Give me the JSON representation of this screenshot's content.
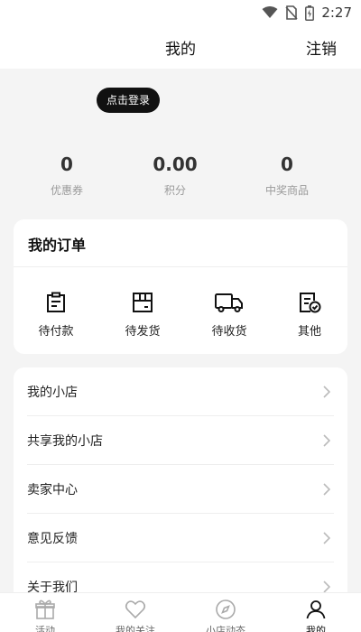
{
  "status_bar": {
    "time": "2:27"
  },
  "header": {
    "title": "我的",
    "logout_label": "注销"
  },
  "login": {
    "button_label": "点击登录"
  },
  "stats": [
    {
      "value": "0",
      "label": "优惠券"
    },
    {
      "value": "0.00",
      "label": "积分"
    },
    {
      "value": "0",
      "label": "中奖商品"
    }
  ],
  "orders": {
    "title": "我的订单",
    "items": [
      {
        "label": "待付款",
        "icon": "clipboard-icon"
      },
      {
        "label": "待发货",
        "icon": "package-icon"
      },
      {
        "label": "待收货",
        "icon": "truck-icon"
      },
      {
        "label": "其他",
        "icon": "checked-doc-icon"
      }
    ]
  },
  "menu": {
    "items": [
      {
        "label": "我的小店"
      },
      {
        "label": "共享我的小店"
      },
      {
        "label": "卖家中心"
      },
      {
        "label": "意见反馈"
      },
      {
        "label": "关于我们"
      }
    ]
  },
  "bottom_nav": {
    "items": [
      {
        "label": "活动",
        "icon": "gift-icon"
      },
      {
        "label": "我的关注",
        "icon": "heart-icon"
      },
      {
        "label": "小店动态",
        "icon": "compass-icon"
      },
      {
        "label": "我的",
        "icon": "user-icon"
      }
    ],
    "active": "我的"
  }
}
